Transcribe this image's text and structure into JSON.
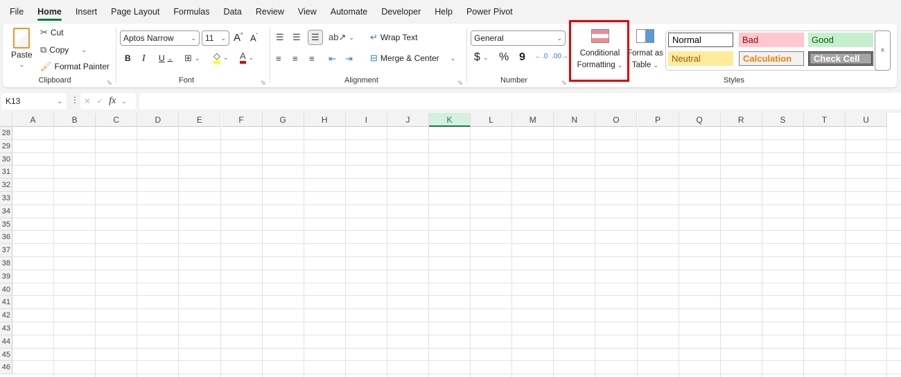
{
  "menu": [
    "File",
    "Home",
    "Insert",
    "Page Layout",
    "Formulas",
    "Data",
    "Review",
    "View",
    "Automate",
    "Developer",
    "Help",
    "Power Pivot"
  ],
  "active_tab": "Home",
  "clipboard": {
    "paste": "Paste",
    "cut": "Cut",
    "copy": "Copy",
    "format_painter": "Format Painter",
    "label": "Clipboard"
  },
  "font": {
    "name": "Aptos Narrow",
    "size": "11",
    "bold": "B",
    "italic": "I",
    "underline": "U",
    "label": "Font",
    "font_color": "#e00000",
    "fill_color": "#ffff00"
  },
  "alignment": {
    "wrap_text": "Wrap Text",
    "merge_center": "Merge & Center",
    "label": "Alignment"
  },
  "number": {
    "format": "General",
    "currency": "$",
    "percent": "%",
    "comma": "9",
    "label": "Number"
  },
  "styles": {
    "conditional_formatting": [
      "Conditional",
      "Formatting"
    ],
    "format_as_table": [
      "Format as",
      "Table"
    ],
    "label": "Styles",
    "cells": [
      {
        "name": "Normal",
        "bg": "#ffffff",
        "fg": "#000000"
      },
      {
        "name": "Bad",
        "bg": "#ffc7ce",
        "fg": "#9c0006"
      },
      {
        "name": "Good",
        "bg": "#c6efce",
        "fg": "#006100"
      },
      {
        "name": "Neutral",
        "bg": "#ffeb9c",
        "fg": "#9c5700"
      },
      {
        "name": "Calculation",
        "bg": "#f2f2f2",
        "fg": "#fa7d00"
      },
      {
        "name": "Check Cell",
        "bg": "#a5a5a5",
        "fg": "#ffffff"
      }
    ]
  },
  "formula_bar": {
    "name_box": "K13",
    "fx": "fx",
    "value": ""
  },
  "sheet": {
    "columns": [
      "A",
      "B",
      "C",
      "D",
      "E",
      "F",
      "G",
      "H",
      "I",
      "J",
      "K",
      "L",
      "M",
      "N",
      "O",
      "P",
      "Q",
      "R",
      "S",
      "T",
      "U"
    ],
    "selected_column": "K",
    "rows": [
      "28",
      "29",
      "30",
      "31",
      "32",
      "33",
      "34",
      "35",
      "36",
      "37",
      "38",
      "39",
      "40",
      "41",
      "42",
      "43",
      "44",
      "45",
      "46"
    ]
  },
  "highlight_color": "#e00000"
}
